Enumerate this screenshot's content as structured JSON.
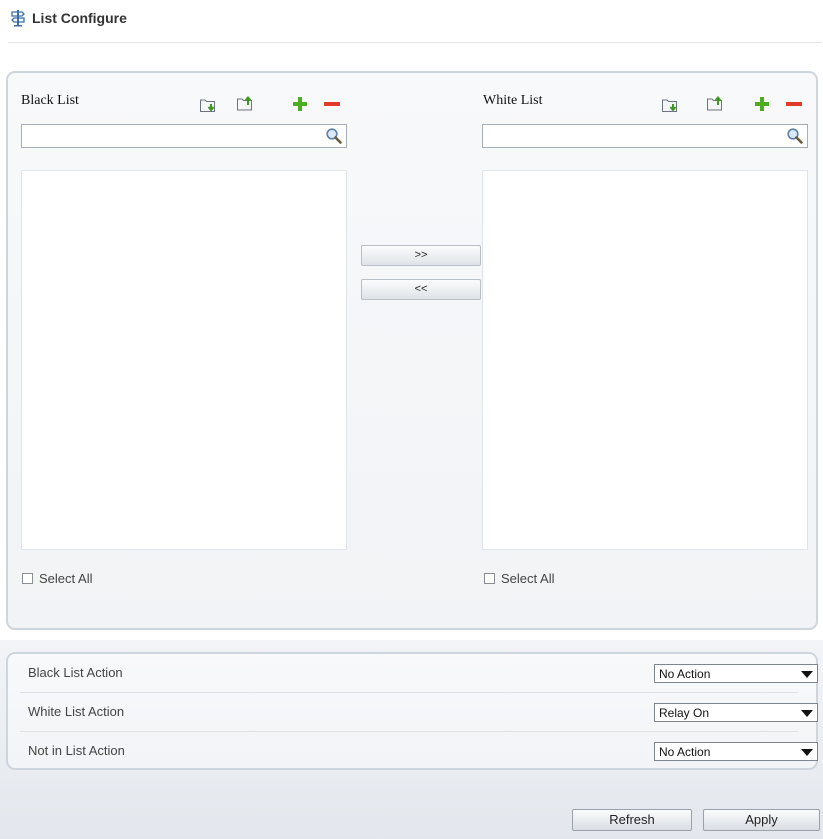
{
  "header": {
    "title": "List Configure",
    "icon": "signpost-icon"
  },
  "black_list": {
    "title": "Black List",
    "search_value": "",
    "items": [],
    "select_all_label": "Select All",
    "select_all_checked": false,
    "tools": [
      "import-icon",
      "export-icon",
      "add-icon",
      "remove-icon"
    ]
  },
  "white_list": {
    "title": "White List",
    "search_value": "",
    "items": [],
    "select_all_label": "Select All",
    "select_all_checked": false,
    "tools": [
      "import-icon",
      "export-icon",
      "add-icon",
      "remove-icon"
    ]
  },
  "transfer": {
    "move_right_label": ">>",
    "move_left_label": "<<"
  },
  "actions": [
    {
      "label": "Black List Action",
      "selected": "No Action"
    },
    {
      "label": "White List Action",
      "selected": "Relay On"
    },
    {
      "label": "Not in List Action",
      "selected": "No Action"
    }
  ],
  "footer": {
    "refresh_label": "Refresh",
    "apply_label": "Apply"
  },
  "colors": {
    "panel_border": "#cfd5dd",
    "add_green": "#4cae1f",
    "remove_red": "#e23a2a"
  }
}
